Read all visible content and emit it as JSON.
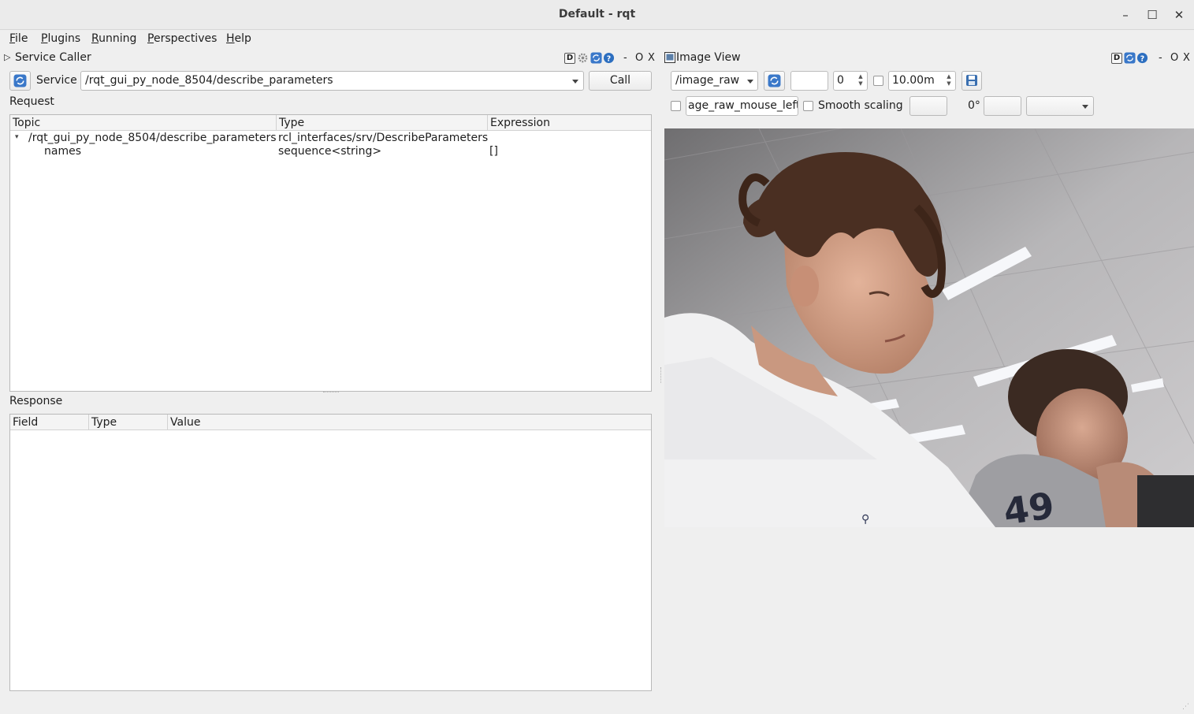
{
  "window": {
    "title": "Default - rqt",
    "controls": {
      "minimize": "–",
      "maximize": "☐",
      "close": "✕"
    }
  },
  "menubar": {
    "items": [
      {
        "label_u": "F",
        "label_rest": "ile"
      },
      {
        "label_u": "P",
        "label_rest": "lugins"
      },
      {
        "label_u": "R",
        "label_rest": "unning"
      },
      {
        "label_u": "P",
        "label_rest": "erspectives"
      },
      {
        "label_u": "H",
        "label_rest": "elp"
      }
    ]
  },
  "service_caller": {
    "title": "Service Caller",
    "dock_controls": {
      "d": "D",
      "dash": "-",
      "o": "O",
      "x": "X"
    },
    "service_label": "Service",
    "service_value": "/rqt_gui_py_node_8504/describe_parameters",
    "call_label": "Call",
    "request_label": "Request",
    "request_columns": [
      "Topic",
      "Type",
      "Expression"
    ],
    "request_rows": [
      {
        "topic": "/rqt_gui_py_node_8504/describe_parameters",
        "type": "rcl_interfaces/srv/DescribeParameters",
        "expression": ""
      },
      {
        "topic": "names",
        "type": "sequence<string>",
        "expression": "[]"
      }
    ],
    "response_label": "Response",
    "response_columns": [
      "Field",
      "Type",
      "Value"
    ]
  },
  "image_view": {
    "title": "Image View",
    "dock_controls": {
      "d": "D",
      "dash": "-",
      "o": "O",
      "x": "X"
    },
    "topic_value": "/image_raw",
    "spin_value": "0",
    "max_value": "10.00m",
    "mouse_topic": "age_raw_mouse_left",
    "smooth_scaling_label": "Smooth scaling",
    "rotation_label": "0°"
  },
  "colors": {
    "background": "#efefef",
    "table_bg": "#ffffff",
    "accent_icon": "#2d6fc0"
  }
}
